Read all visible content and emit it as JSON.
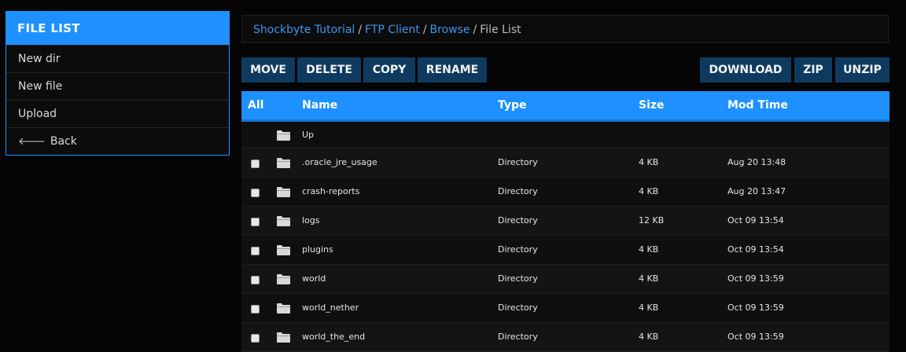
{
  "sidebar": {
    "title": "FILE LIST",
    "items": [
      {
        "label": "New dir"
      },
      {
        "label": "New file"
      },
      {
        "label": "Upload"
      },
      {
        "label": "Back",
        "icon": "arrow-left-icon"
      }
    ]
  },
  "breadcrumb": {
    "links": [
      "Shockbyte Tutorial",
      "FTP Client",
      "Browse"
    ],
    "separator": "/",
    "current": "File List"
  },
  "toolbar": {
    "move": "MOVE",
    "delete": "DELETE",
    "copy": "COPY",
    "rename": "RENAME",
    "download": "DOWNLOAD",
    "zip": "ZIP",
    "unzip": "UNZIP"
  },
  "table": {
    "headers": {
      "all": "All",
      "name": "Name",
      "type": "Type",
      "size": "Size",
      "mtime": "Mod Time"
    },
    "up_label": "Up",
    "rows": [
      {
        "name": ".oracle_jre_usage",
        "type": "Directory",
        "size": "4 KB",
        "mtime": "Aug 20 13:48"
      },
      {
        "name": "crash-reports",
        "type": "Directory",
        "size": "4 KB",
        "mtime": "Aug 20 13:47"
      },
      {
        "name": "logs",
        "type": "Directory",
        "size": "12 KB",
        "mtime": "Oct 09 13:54"
      },
      {
        "name": "plugins",
        "type": "Directory",
        "size": "4 KB",
        "mtime": "Oct 09 13:54"
      },
      {
        "name": "world",
        "type": "Directory",
        "size": "4 KB",
        "mtime": "Oct 09 13:59"
      },
      {
        "name": "world_nether",
        "type": "Directory",
        "size": "4 KB",
        "mtime": "Oct 09 13:59"
      },
      {
        "name": "world_the_end",
        "type": "Directory",
        "size": "4 KB",
        "mtime": "Oct 09 13:59"
      }
    ]
  },
  "colors": {
    "accent": "#1e90ff",
    "button": "#0e3a5f",
    "link": "#3c97f0",
    "background": "#050505"
  }
}
